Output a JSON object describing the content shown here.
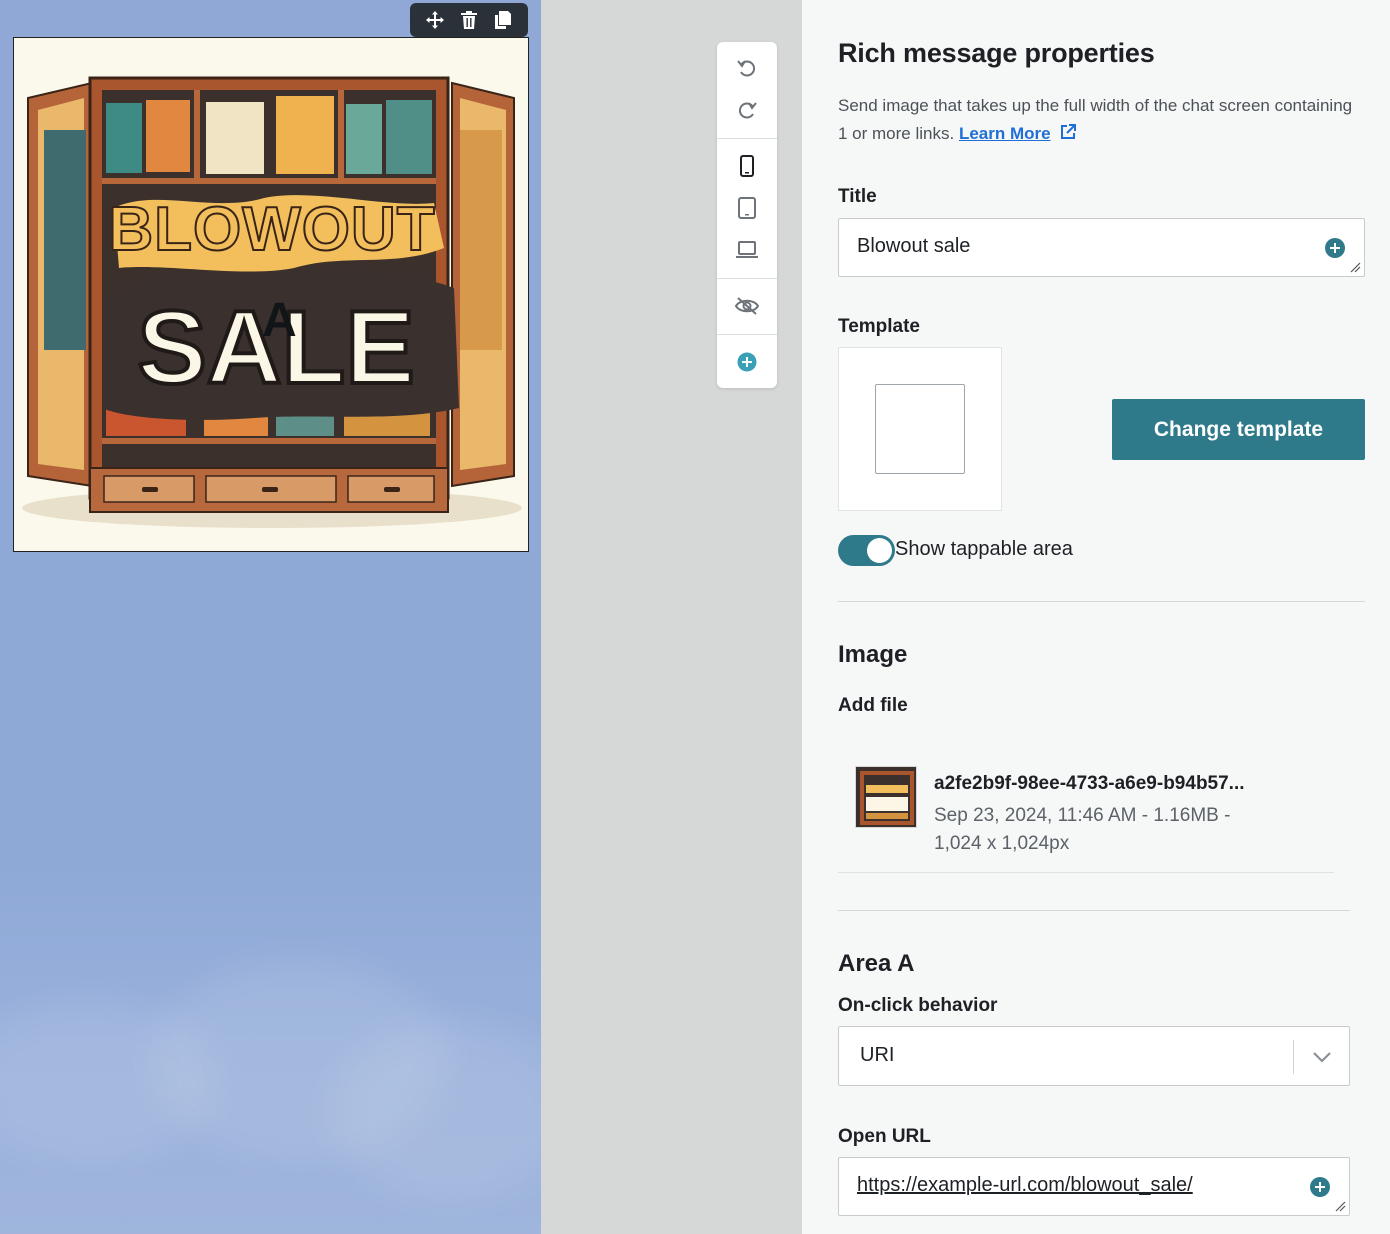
{
  "toolbar": {
    "icons": [
      "move-icon",
      "trash-icon",
      "copy-icon"
    ]
  },
  "image": {
    "area_label": "A"
  },
  "side_toolbar": {
    "icons": [
      "undo-icon",
      "redo-icon",
      "phone-icon",
      "tablet-icon",
      "laptop-icon",
      "eye-off-icon",
      "plus-circle-icon"
    ]
  },
  "panel": {
    "title": "Rich message properties",
    "description": "Send image that takes up the full width of the chat screen containing 1 or more links. ",
    "learn_more": "Learn More",
    "title_label": "Title",
    "title_value": "Blowout sale",
    "template_label": "Template",
    "change_template": "Change template",
    "show_tappable": "Show tappable area",
    "image_section": "Image",
    "add_file": "Add file",
    "file": {
      "name": "a2fe2b9f-98ee-4733-a6e9-b94b57...",
      "meta": "Sep 23, 2024, 11:46 AM  -  1.16MB  -  1,024 x 1,024px"
    },
    "area_section": "Area A",
    "onclick_label": "On-click behavior",
    "onclick_value": "URI",
    "open_url_label": "Open URL",
    "open_url_value": "https://example-url.com/blowout_sale/"
  },
  "colors": {
    "accent": "#2f7a8a",
    "link": "#1f6fd6",
    "canvas_bg": "#8fa8d6"
  }
}
